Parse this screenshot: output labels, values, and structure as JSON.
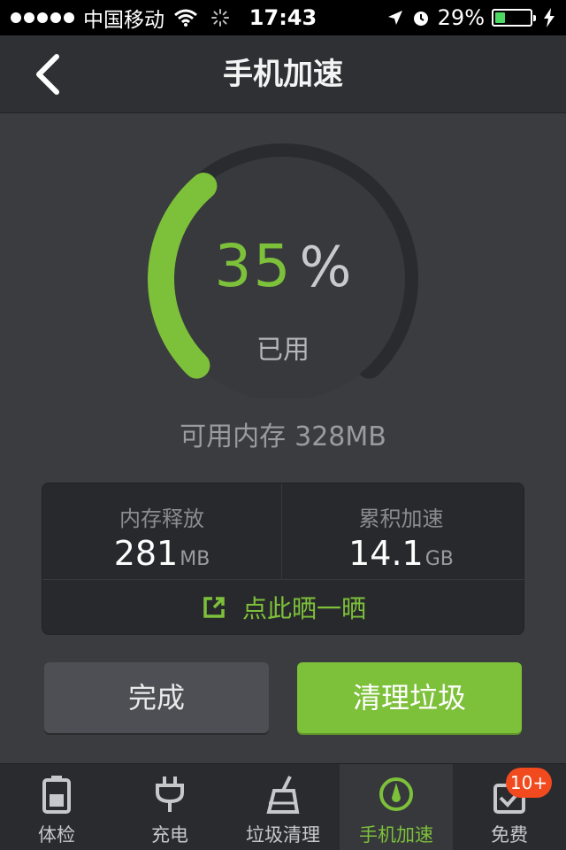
{
  "status_bar": {
    "carrier": "中国移动",
    "time": "17:43",
    "battery": "29%",
    "battery_level": 0.29,
    "icons": [
      "signal-dots-icon",
      "wifi-icon",
      "activity-spinner-icon",
      "location-arrow-icon",
      "alarm-icon",
      "battery-icon",
      "charging-bolt-icon"
    ]
  },
  "header": {
    "title": "手机加速",
    "back_icon": "chevron-left-icon"
  },
  "gauge": {
    "percent_value": "35",
    "percent_unit": "%",
    "used_label": "已用",
    "used_fraction": 0.35,
    "colors": {
      "used": "#7dc03a",
      "track": "#2a2b2e"
    }
  },
  "memory": {
    "available_label": "可用内存",
    "available_value": "328MB"
  },
  "stats": {
    "released": {
      "label": "内存释放",
      "value": "281",
      "unit": "MB"
    },
    "accumulated": {
      "label": "累积加速",
      "value": "14.1",
      "unit": "GB"
    },
    "share_label": "点此晒一晒",
    "share_icon": "external-share-icon"
  },
  "buttons": {
    "done": "完成",
    "clean": "清理垃圾"
  },
  "tabbar": {
    "tabs": [
      {
        "label": "体检",
        "icon": "battery-check-icon",
        "active": false
      },
      {
        "label": "充电",
        "icon": "plug-icon",
        "active": false
      },
      {
        "label": "垃圾清理",
        "icon": "broom-icon",
        "active": false
      },
      {
        "label": "手机加速",
        "icon": "speedometer-icon",
        "active": true
      },
      {
        "label": "免费",
        "icon": "gift-check-icon",
        "active": false
      }
    ],
    "badge": "10+"
  },
  "colors": {
    "accent": "#7dc03a",
    "background": "#3a3c40",
    "badge": "#f14a1f"
  }
}
